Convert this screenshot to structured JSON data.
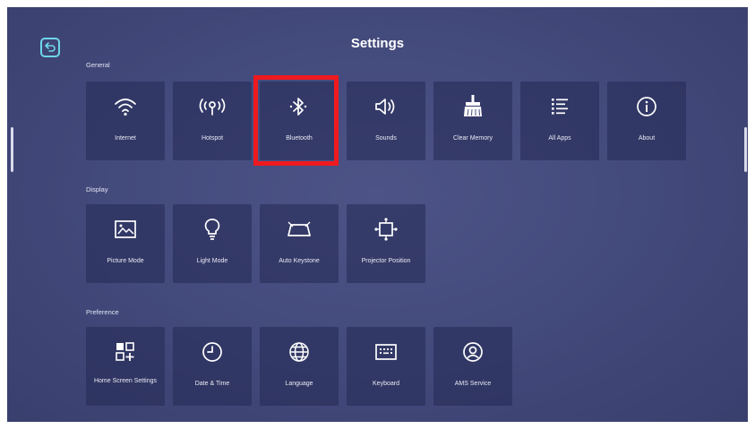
{
  "title": "Settings",
  "sections": {
    "general": {
      "label": "General",
      "items": [
        {
          "label": "Internet",
          "icon": "wifi-icon"
        },
        {
          "label": "Hotspot",
          "icon": "hotspot-icon"
        },
        {
          "label": "Bluetooth",
          "icon": "bluetooth-icon"
        },
        {
          "label": "Sounds",
          "icon": "speaker-icon"
        },
        {
          "label": "Clear Memory",
          "icon": "broom-icon"
        },
        {
          "label": "All Apps",
          "icon": "list-icon"
        },
        {
          "label": "About",
          "icon": "info-icon"
        }
      ]
    },
    "display": {
      "label": "Display",
      "items": [
        {
          "label": "Picture Mode",
          "icon": "picture-icon"
        },
        {
          "label": "Light Mode",
          "icon": "lightbulb-icon"
        },
        {
          "label": "Auto Keystone",
          "icon": "keystone-icon"
        },
        {
          "label": "Projector Position",
          "icon": "projector-position-icon"
        }
      ]
    },
    "preference": {
      "label": "Preference",
      "items": [
        {
          "label": "Home Screen Settings",
          "icon": "home-grid-icon"
        },
        {
          "label": "Date & Time",
          "icon": "clock-icon"
        },
        {
          "label": "Language",
          "icon": "globe-icon"
        },
        {
          "label": "Keyboard",
          "icon": "keyboard-icon"
        },
        {
          "label": "AMS Service",
          "icon": "account-icon"
        }
      ]
    }
  },
  "colors": {
    "background": "#434a7c",
    "tile": "#2c3263",
    "highlight": "#ef1a1f",
    "back_button": "#6fd6ea"
  }
}
